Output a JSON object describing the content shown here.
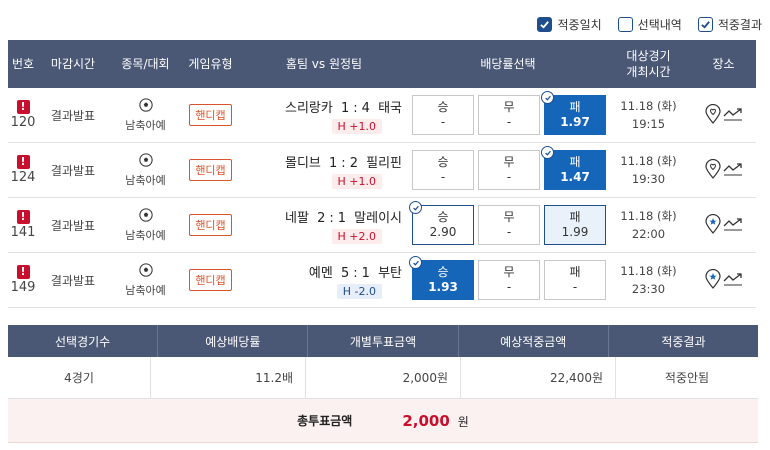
{
  "filters": [
    {
      "label": "적중일치",
      "state": "checked"
    },
    {
      "label": "선택내역",
      "state": "unchecked"
    },
    {
      "label": "적중결과",
      "state": "outline-checked"
    }
  ],
  "table": {
    "headers": {
      "no": "번호",
      "close_time": "마감시간",
      "sport": "종목/대회",
      "game_type": "게임유형",
      "teams": "홈팀 vs 원정팀",
      "odds": "배당률선택",
      "date_line1": "대상경기",
      "date_line2": "개최시간",
      "place": "장소"
    },
    "rows": [
      {
        "no": "120",
        "status": "결과발표",
        "league": "남축아예",
        "game_type": "핸디캡",
        "home": "스리랑카",
        "home_score": "1",
        "away_score": "4",
        "away": "태국",
        "handicap": "H +1.0",
        "handicap_kind": "plus",
        "odds": [
          {
            "label": "승",
            "value": "-",
            "state": "normal"
          },
          {
            "label": "무",
            "value": "-",
            "state": "normal"
          },
          {
            "label": "패",
            "value": "1.97",
            "state": "filled"
          }
        ],
        "date": "11.18 (화)",
        "time": "19:15",
        "place_icon": "heart-pin-icon"
      },
      {
        "no": "124",
        "status": "결과발표",
        "league": "남축아예",
        "game_type": "핸디캡",
        "home": "몰디브",
        "home_score": "1",
        "away_score": "2",
        "away": "필리핀",
        "handicap": "H +1.0",
        "handicap_kind": "plus",
        "odds": [
          {
            "label": "승",
            "value": "-",
            "state": "normal"
          },
          {
            "label": "무",
            "value": "-",
            "state": "normal"
          },
          {
            "label": "패",
            "value": "1.47",
            "state": "filled"
          }
        ],
        "date": "11.18 (화)",
        "time": "19:30",
        "place_icon": "heart-pin-icon"
      },
      {
        "no": "141",
        "status": "결과발표",
        "league": "남축아예",
        "game_type": "핸디캡",
        "home": "네팔",
        "home_score": "2",
        "away_score": "1",
        "away": "말레이시",
        "handicap": "H +2.0",
        "handicap_kind": "plus",
        "odds": [
          {
            "label": "승",
            "value": "2.90",
            "state": "outline"
          },
          {
            "label": "무",
            "value": "-",
            "state": "normal"
          },
          {
            "label": "패",
            "value": "1.99",
            "state": "highlight"
          }
        ],
        "date": "11.18 (화)",
        "time": "22:00",
        "place_icon": "star-pin-icon"
      },
      {
        "no": "149",
        "status": "결과발표",
        "league": "남축아예",
        "game_type": "핸디캡",
        "home": "예멘",
        "home_score": "5",
        "away_score": "1",
        "away": "부탄",
        "handicap": "H -2.0",
        "handicap_kind": "minus",
        "odds": [
          {
            "label": "승",
            "value": "1.93",
            "state": "filled-tick"
          },
          {
            "label": "무",
            "value": "-",
            "state": "normal"
          },
          {
            "label": "패",
            "value": "-",
            "state": "normal"
          }
        ],
        "date": "11.18 (화)",
        "time": "23:30",
        "place_icon": "star-pin-icon"
      }
    ]
  },
  "summary": {
    "headers": [
      "선택경기수",
      "예상배당률",
      "개별투표금액",
      "예상적중금액",
      "적중결과"
    ],
    "values": [
      "4경기",
      "11.2배",
      "2,000원",
      "22,400원",
      "적중안됨"
    ],
    "total_label": "총투표금액",
    "total_value": "2,000",
    "total_unit": "원"
  },
  "colors": {
    "header_bg": "#4a5775",
    "accent_blue": "#1565b8",
    "alert_red": "#c8102e",
    "handicap_orange": "#d8542a"
  }
}
